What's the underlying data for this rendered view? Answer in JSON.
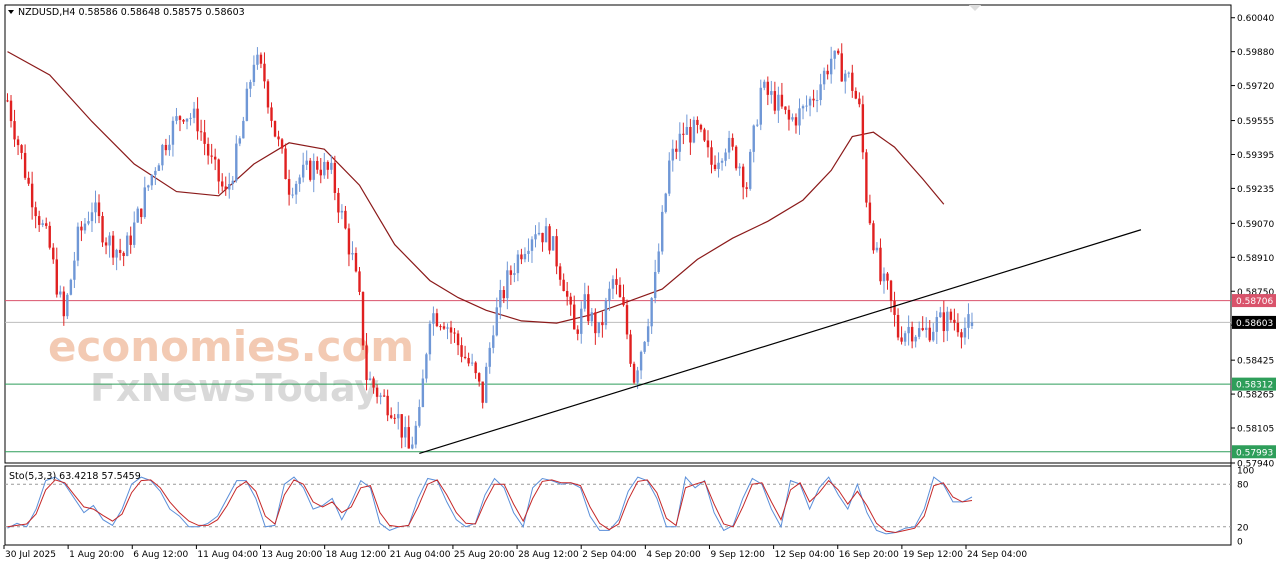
{
  "header": {
    "symbol_line": "NZDUSD,H4  0.58586 0.58648 0.58575 0.58603",
    "collapse_icon": "triangle-down-icon"
  },
  "watermark": {
    "line1": "economies.com",
    "line2": "FxNewsToday"
  },
  "colors": {
    "bull": "#6f97d6",
    "bear": "#e02020",
    "ma": "#8b1a1a",
    "trendline": "#000000",
    "resistance": "#d9536b",
    "support": "#2e9e5a",
    "current": "#bdbdbd",
    "stoch_k": "#5b8fd9",
    "stoch_d": "#c62828"
  },
  "chart_data": [
    {
      "type": "candlestick",
      "title": "NZDUSD,H4",
      "ohlc_last": {
        "open": 0.58586,
        "high": 0.58648,
        "low": 0.58575,
        "close": 0.58603
      },
      "ylim": [
        0.5794,
        0.601
      ],
      "y_ticks": [
        "0.60040",
        "0.59880",
        "0.59720",
        "0.59555",
        "0.59395",
        "0.59235",
        "0.59070",
        "0.58910",
        "0.58750",
        "0.58590",
        "0.58425",
        "0.58265",
        "0.58105",
        "0.57940"
      ],
      "x_ticks": [
        "30 Jul 2025",
        "1 Aug 20:00",
        "6 Aug 12:00",
        "11 Aug 04:00",
        "13 Aug 20:00",
        "18 Aug 12:00",
        "21 Aug 04:00",
        "25 Aug 20:00",
        "28 Aug 12:00",
        "2 Sep 04:00",
        "4 Sep 20:00",
        "9 Sep 12:00",
        "12 Sep 04:00",
        "16 Sep 20:00",
        "19 Sep 12:00",
        "24 Sep 04:00"
      ],
      "price_path": [
        [
          0,
          0.5965
        ],
        [
          6,
          0.5925
        ],
        [
          12,
          0.5895
        ],
        [
          16,
          0.5862
        ],
        [
          20,
          0.59
        ],
        [
          24,
          0.5915
        ],
        [
          28,
          0.59
        ],
        [
          33,
          0.5892
        ],
        [
          37,
          0.591
        ],
        [
          42,
          0.5935
        ],
        [
          46,
          0.595
        ],
        [
          50,
          0.596
        ],
        [
          54,
          0.5955
        ],
        [
          58,
          0.5935
        ],
        [
          62,
          0.592
        ],
        [
          66,
          0.5945
        ],
        [
          70,
          0.5985
        ],
        [
          73,
          0.5975
        ],
        [
          76,
          0.595
        ],
        [
          80,
          0.5925
        ],
        [
          84,
          0.593
        ],
        [
          88,
          0.5935
        ],
        [
          92,
          0.593
        ],
        [
          95,
          0.591
        ],
        [
          98,
          0.589
        ],
        [
          100,
          0.587
        ],
        [
          102,
          0.5835
        ],
        [
          106,
          0.5825
        ],
        [
          110,
          0.582
        ],
        [
          114,
          0.58
        ],
        [
          117,
          0.5815
        ],
        [
          120,
          0.5865
        ],
        [
          124,
          0.5862
        ],
        [
          128,
          0.585
        ],
        [
          132,
          0.5838
        ],
        [
          135,
          0.5825
        ],
        [
          138,
          0.586
        ],
        [
          142,
          0.588
        ],
        [
          146,
          0.5895
        ],
        [
          150,
          0.5905
        ],
        [
          154,
          0.59
        ],
        [
          158,
          0.588
        ],
        [
          161,
          0.5855
        ],
        [
          164,
          0.5868
        ],
        [
          168,
          0.5855
        ],
        [
          172,
          0.588
        ],
        [
          175,
          0.5865
        ],
        [
          178,
          0.5835
        ],
        [
          181,
          0.5855
        ],
        [
          184,
          0.588
        ],
        [
          188,
          0.5935
        ],
        [
          192,
          0.595
        ],
        [
          196,
          0.595
        ],
        [
          200,
          0.5935
        ],
        [
          204,
          0.5945
        ],
        [
          208,
          0.5935
        ],
        [
          210,
          0.5925
        ],
        [
          214,
          0.597
        ],
        [
          218,
          0.5965
        ],
        [
          222,
          0.5955
        ],
        [
          226,
          0.596
        ],
        [
          230,
          0.597
        ],
        [
          234,
          0.5985
        ],
        [
          238,
          0.5978
        ],
        [
          240,
          0.5972
        ],
        [
          242,
          0.596
        ],
        [
          244,
          0.592
        ],
        [
          246,
          0.59
        ],
        [
          248,
          0.588
        ],
        [
          250,
          0.5875
        ],
        [
          253,
          0.5855
        ],
        [
          256,
          0.5858
        ],
        [
          260,
          0.5855
        ],
        [
          264,
          0.586
        ],
        [
          268,
          0.5862
        ],
        [
          272,
          0.5858
        ],
        [
          274,
          0.586
        ]
      ],
      "moving_average": [
        [
          0,
          0.5988
        ],
        [
          12,
          0.5977
        ],
        [
          24,
          0.5955
        ],
        [
          36,
          0.5935
        ],
        [
          48,
          0.5922
        ],
        [
          60,
          0.592
        ],
        [
          70,
          0.5935
        ],
        [
          80,
          0.5945
        ],
        [
          90,
          0.5942
        ],
        [
          100,
          0.5925
        ],
        [
          110,
          0.5897
        ],
        [
          120,
          0.588
        ],
        [
          128,
          0.5872
        ],
        [
          136,
          0.5866
        ],
        [
          146,
          0.5861
        ],
        [
          156,
          0.586
        ],
        [
          166,
          0.5864
        ],
        [
          176,
          0.587
        ],
        [
          186,
          0.5876
        ],
        [
          196,
          0.589
        ],
        [
          206,
          0.59
        ],
        [
          216,
          0.5908
        ],
        [
          226,
          0.5918
        ],
        [
          234,
          0.5932
        ],
        [
          240,
          0.5948
        ],
        [
          246,
          0.595
        ],
        [
          252,
          0.5943
        ],
        [
          260,
          0.5928
        ],
        [
          266,
          0.5916
        ]
      ],
      "trendline": {
        "from": [
          117,
          0.57985
        ],
        "to": [
          322,
          0.5904
        ]
      },
      "price_labels": [
        {
          "name": "resistance",
          "value": 0.58706,
          "label": "0.58706"
        },
        {
          "name": "current",
          "value": 0.58603,
          "label": "0.58603"
        },
        {
          "name": "support-1",
          "value": 0.58312,
          "label": "0.58312"
        },
        {
          "name": "support-2",
          "value": 0.57993,
          "label": "0.57993"
        }
      ],
      "grid": false
    },
    {
      "type": "line",
      "title": "Sto(5,3,3) 63.4218 57.5459",
      "ylim": [
        0,
        100
      ],
      "y_ticks": [
        "100",
        "80",
        "20",
        "0"
      ],
      "levels": [
        80,
        20
      ],
      "series": [
        {
          "values": [
            18,
            25,
            20,
            45,
            85,
            90,
            80,
            60,
            40,
            50,
            30,
            22,
            45,
            80,
            90,
            85,
            70,
            45,
            35,
            20,
            20,
            25,
            35,
            60,
            85,
            85,
            60,
            20,
            22,
            80,
            90,
            75,
            45,
            50,
            60,
            30,
            55,
            85,
            75,
            25,
            15,
            20,
            22,
            60,
            88,
            85,
            55,
            30,
            20,
            25,
            65,
            88,
            75,
            40,
            20,
            75,
            88,
            85,
            80,
            82,
            75,
            35,
            15,
            15,
            30,
            70,
            90,
            85,
            60,
            20,
            20,
            90,
            75,
            85,
            40,
            15,
            22,
            60,
            88,
            80,
            45,
            20,
            85,
            80,
            45,
            75,
            90,
            65,
            45,
            80,
            40,
            15,
            10,
            12,
            18,
            20,
            45,
            90,
            80,
            55,
            55,
            62
          ]
        },
        {
          "values": [
            20,
            22,
            24,
            38,
            72,
            86,
            82,
            65,
            48,
            45,
            36,
            28,
            38,
            68,
            85,
            86,
            75,
            55,
            40,
            28,
            22,
            22,
            30,
            50,
            75,
            84,
            70,
            35,
            24,
            65,
            86,
            80,
            55,
            48,
            55,
            40,
            48,
            75,
            78,
            40,
            22,
            20,
            22,
            48,
            80,
            86,
            65,
            40,
            25,
            24,
            55,
            80,
            80,
            52,
            28,
            60,
            84,
            86,
            82,
            82,
            78,
            48,
            25,
            16,
            24,
            58,
            84,
            86,
            68,
            32,
            22,
            75,
            80,
            84,
            52,
            24,
            20,
            48,
            80,
            82,
            55,
            30,
            72,
            82,
            55,
            68,
            85,
            72,
            52,
            70,
            50,
            25,
            14,
            12,
            15,
            18,
            35,
            78,
            82,
            62,
            55,
            57
          ]
        }
      ]
    }
  ]
}
